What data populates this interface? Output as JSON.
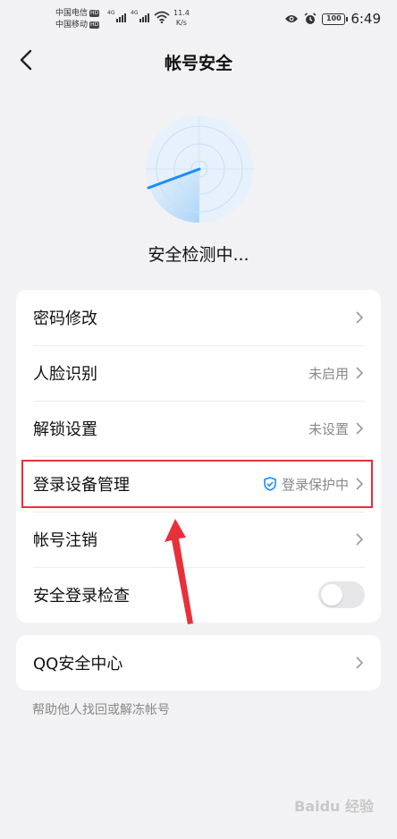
{
  "status_bar": {
    "carrier1": "中国电信",
    "carrier2": "中国移动",
    "hd": "HD",
    "net": "4G",
    "speed_value": "11.4",
    "speed_unit": "K/s",
    "battery": "100",
    "time": "6:49"
  },
  "header": {
    "title": "帐号安全",
    "back_icon": "chevron-left-icon"
  },
  "scan": {
    "status_text": "安全检测中..."
  },
  "settings": [
    {
      "label": "密码修改",
      "value": ""
    },
    {
      "label": "人脸识别",
      "value": "未启用"
    },
    {
      "label": "解锁设置",
      "value": "未设置"
    },
    {
      "label": "登录设备管理",
      "value": "登录保护中",
      "icon": "shield-check-icon"
    },
    {
      "label": "帐号注销",
      "value": ""
    },
    {
      "label": "安全登录检查",
      "toggle": false
    }
  ],
  "qq_center": {
    "label": "QQ安全中心",
    "help": "帮助他人找回或解冻帐号"
  },
  "colors": {
    "background": "#f2f2f4",
    "accent_blue": "#1a8cff",
    "highlight_red": "#e8303a"
  },
  "watermark": "Baidu 经验"
}
